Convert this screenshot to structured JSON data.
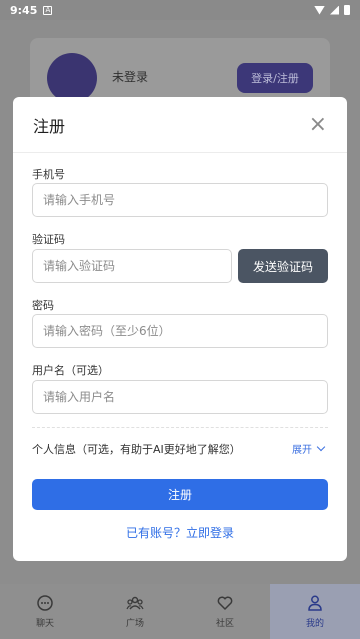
{
  "status_bar": {
    "time": "9:45",
    "notification": "A"
  },
  "background": {
    "login_status": "未登录",
    "login_button": "登录/注册"
  },
  "modal": {
    "title": "注册",
    "phone": {
      "label": "手机号",
      "placeholder": "请输入手机号",
      "value": ""
    },
    "code": {
      "label": "验证码",
      "placeholder": "请输入验证码",
      "value": "",
      "send_button": "发送验证码"
    },
    "password": {
      "label": "密码",
      "placeholder": "请输入密码（至少6位）",
      "value": ""
    },
    "username": {
      "label": "用户名（可选）",
      "placeholder": "请输入用户名",
      "value": ""
    },
    "personal_info": {
      "label": "个人信息（可选，有助于AI更好地了解您）",
      "expand": "展开"
    },
    "register_button": "注册",
    "login_link": "已有账号？立即登录"
  },
  "bottom_nav": [
    {
      "label": "聊天",
      "icon": "chat-icon",
      "active": false
    },
    {
      "label": "广场",
      "icon": "group-icon",
      "active": false
    },
    {
      "label": "社区",
      "icon": "heart-icon",
      "active": false
    },
    {
      "label": "我的",
      "icon": "user-icon",
      "active": true
    }
  ],
  "colors": {
    "primary": "#2f6ee6",
    "send_button": "#4b5563",
    "overlay": "#8a8a8a"
  }
}
